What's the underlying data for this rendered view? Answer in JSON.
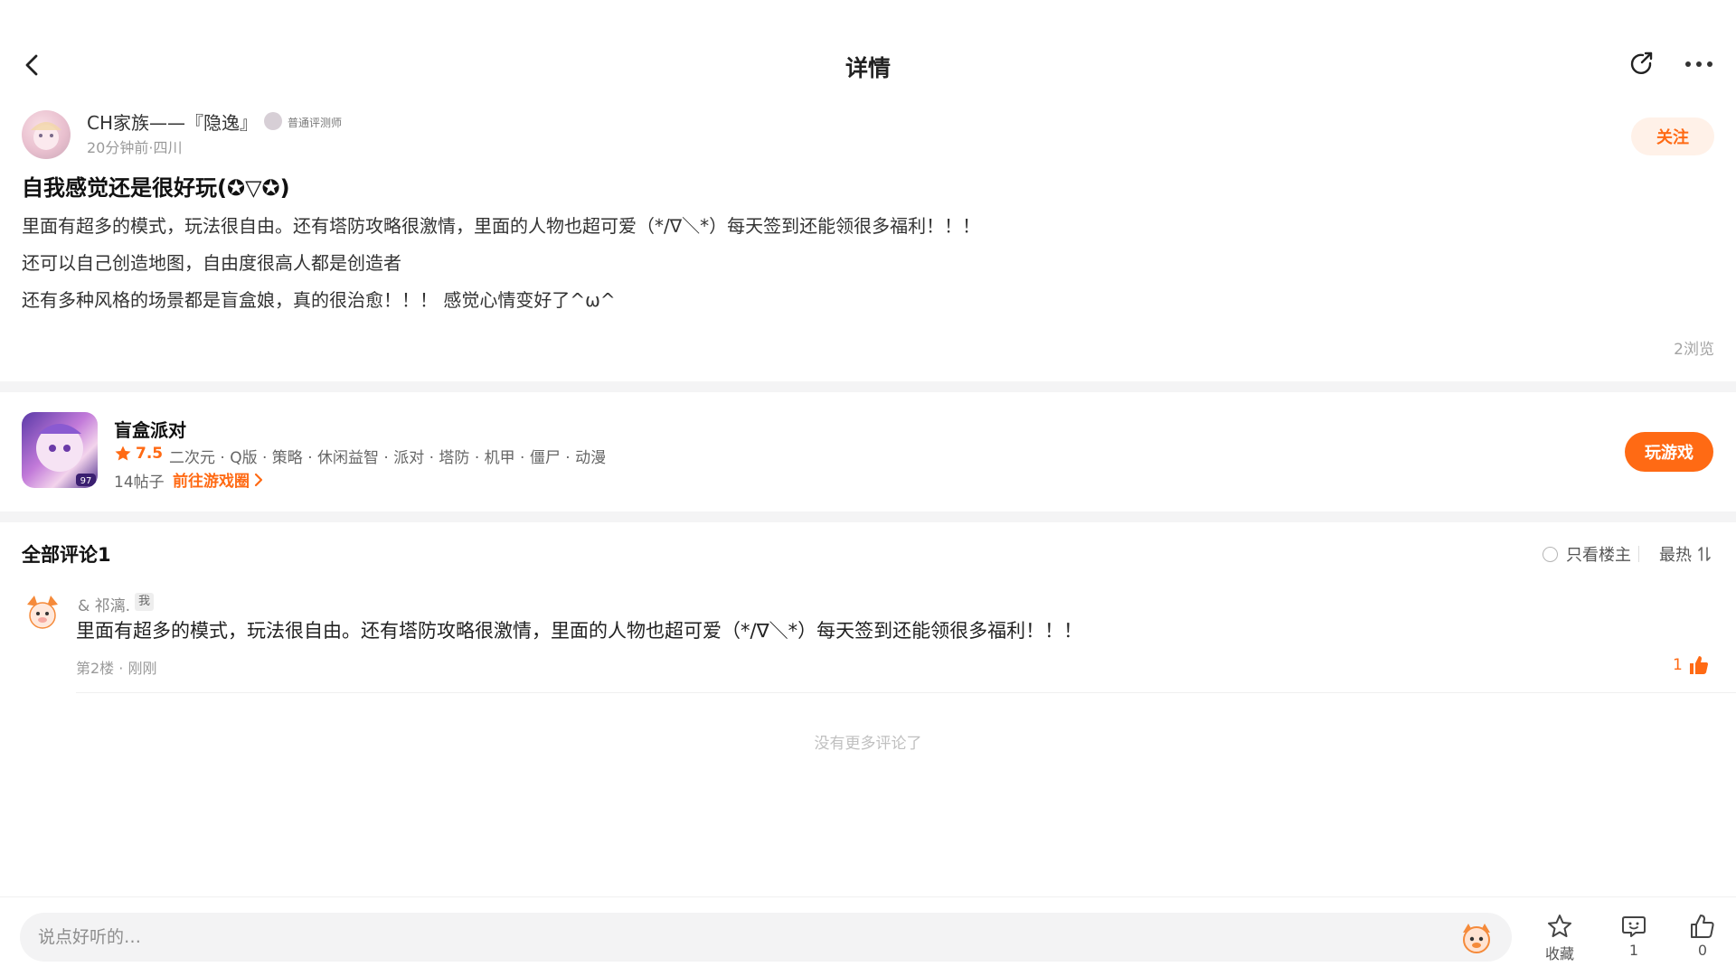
{
  "header": {
    "title": "详情"
  },
  "author": {
    "name": "CH家族——『隐逸』",
    "badge": "普通评测师",
    "meta": "20分钟前·四川",
    "follow_label": "关注"
  },
  "post": {
    "title": "自我感觉还是很好玩(✪▽✪)",
    "lines": [
      "里面有超多的模式，玩法很自由。还有塔防攻略很激情，里面的人物也超可爱（*/∇＼*）每天签到还能领很多福利！！！",
      "还可以自己创造地图，自由度很高人都是创造者",
      "还有多种风格的场景都是盲盒娘，真的很治愈！！！ 感觉心情变好了^ω^"
    ],
    "views": "2浏览"
  },
  "game": {
    "name": "盲盒派对",
    "score": "7.5",
    "tags": "二次元 · Q版 · 策略 · 休闲益智 · 派对 · 塔防 · 机甲 · 僵尸 · 动漫",
    "posts": "14帖子",
    "circle_link": "前往游戏圈",
    "play_label": "玩游戏",
    "icon_badge": "97"
  },
  "comments": {
    "header": "全部评论1",
    "only_op": "只看楼主",
    "sort": "最热",
    "items": [
      {
        "name": "& 祁漓.",
        "tag": "我",
        "text": "里面有超多的模式，玩法很自由。还有塔防攻略很激情，里面的人物也超可爱（*/∇＼*）每天签到还能领很多福利！！！",
        "meta": "第2楼 · 刚刚",
        "likes": "1"
      }
    ],
    "no_more": "没有更多评论了"
  },
  "bottom_bar": {
    "placeholder": "说点好听的…",
    "favorite_label": "收藏",
    "comment_count": "1",
    "like_count": "0"
  },
  "colors": {
    "accent": "#ff6a14",
    "accent_light": "#fff1e8",
    "divider": "#f4f4f5"
  }
}
